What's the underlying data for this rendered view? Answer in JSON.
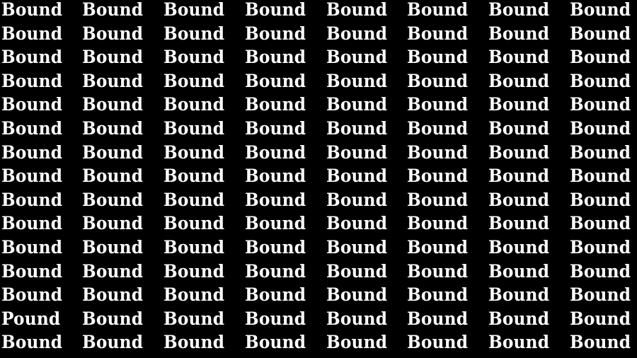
{
  "puzzle": {
    "background_color": "#000000",
    "text_color": "#ffffff",
    "rows": 15,
    "columns": 8,
    "common_word": "Bound",
    "odd_word": "Pound",
    "odd_position": {
      "row": 14,
      "column": 1
    },
    "grid": [
      [
        "Bound",
        "Bound",
        "Bound",
        "Bound",
        "Bound",
        "Bound",
        "Bound",
        "Bound"
      ],
      [
        "Bound",
        "Bound",
        "Bound",
        "Bound",
        "Bound",
        "Bound",
        "Bound",
        "Bound"
      ],
      [
        "Bound",
        "Bound",
        "Bound",
        "Bound",
        "Bound",
        "Bound",
        "Bound",
        "Bound"
      ],
      [
        "Bound",
        "Bound",
        "Bound",
        "Bound",
        "Bound",
        "Bound",
        "Bound",
        "Bound"
      ],
      [
        "Bound",
        "Bound",
        "Bound",
        "Bound",
        "Bound",
        "Bound",
        "Bound",
        "Bound"
      ],
      [
        "Bound",
        "Bound",
        "Bound",
        "Bound",
        "Bound",
        "Bound",
        "Bound",
        "Bound"
      ],
      [
        "Bound",
        "Bound",
        "Bound",
        "Bound",
        "Bound",
        "Bound",
        "Bound",
        "Bound"
      ],
      [
        "Bound",
        "Bound",
        "Bound",
        "Bound",
        "Bound",
        "Bound",
        "Bound",
        "Bound"
      ],
      [
        "Bound",
        "Bound",
        "Bound",
        "Bound",
        "Bound",
        "Bound",
        "Bound",
        "Bound"
      ],
      [
        "Bound",
        "Bound",
        "Bound",
        "Bound",
        "Bound",
        "Bound",
        "Bound",
        "Bound"
      ],
      [
        "Bound",
        "Bound",
        "Bound",
        "Bound",
        "Bound",
        "Bound",
        "Bound",
        "Bound"
      ],
      [
        "Bound",
        "Bound",
        "Bound",
        "Bound",
        "Bound",
        "Bound",
        "Bound",
        "Bound"
      ],
      [
        "Bound",
        "Bound",
        "Bound",
        "Bound",
        "Bound",
        "Bound",
        "Bound",
        "Bound"
      ],
      [
        "Pound",
        "Bound",
        "Bound",
        "Bound",
        "Bound",
        "Bound",
        "Bound",
        "Bound"
      ],
      [
        "Bound",
        "Bound",
        "Bound",
        "Bound",
        "Bound",
        "Bound",
        "Bound",
        "Bound"
      ]
    ]
  }
}
